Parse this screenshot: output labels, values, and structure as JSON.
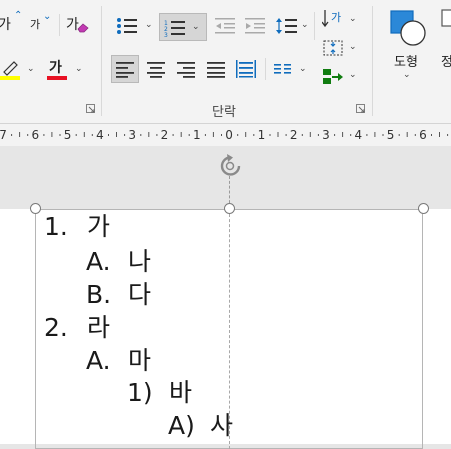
{
  "ribbon": {
    "font_group": {
      "grow_font_glyph": "가",
      "shrink_font_glyph": "가",
      "clear_format_glyph": "가",
      "font_color_glyph": "가",
      "highlight_color": "#ffff00",
      "font_color": "#e81123"
    },
    "paragraph_group": {
      "label": "단락",
      "bullets_icon": "bullets-icon",
      "numbering_icon": "numbering-icon",
      "numbering_selected": true,
      "align_left_selected": true,
      "text_direction_glyph": "가"
    },
    "drawing_group": {
      "shapes_label": "도형",
      "arrange_label_partial": "정"
    }
  },
  "ruler": {
    "ticks": [
      "7",
      "6",
      "5",
      "4",
      "3",
      "2",
      "1",
      "0",
      "1",
      "2",
      "3",
      "4",
      "5",
      "6"
    ]
  },
  "slide": {
    "items": [
      {
        "marker": "1.",
        "text": "가"
      },
      {
        "marker": "A.",
        "text": "나"
      },
      {
        "marker": "B.",
        "text": "다"
      },
      {
        "marker": "2.",
        "text": "라"
      },
      {
        "marker": "A.",
        "text": "마"
      },
      {
        "marker": "1)",
        "text": "바"
      },
      {
        "marker": "A)",
        "text": "사"
      }
    ]
  }
}
